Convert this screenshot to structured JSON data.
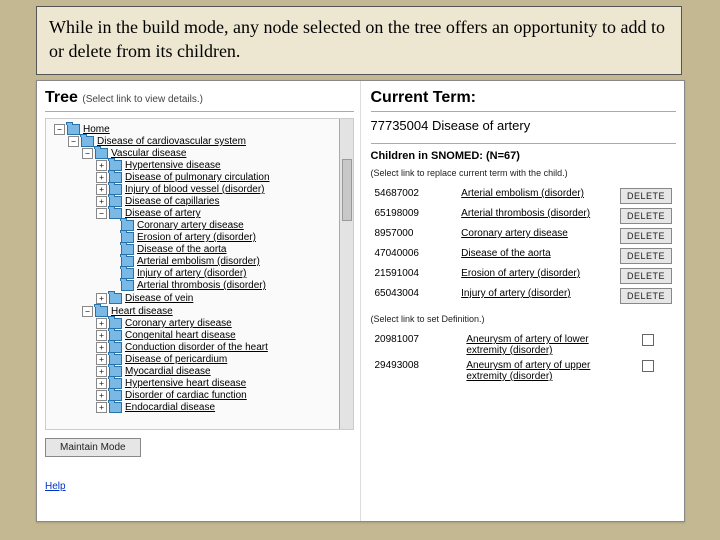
{
  "caption": "While in the build mode, any node selected on the tree offers an opportunity to add to or delete from its children.",
  "left": {
    "heading": "Tree",
    "subheading": "(Select link to view details.)",
    "maintain_button": "Maintain Mode",
    "help_label": "Help",
    "tree": {
      "root_label": "Home",
      "level1_label": "Disease of cardiovascular system",
      "level2": [
        {
          "label": "Vascular disease",
          "expanded": true
        },
        {
          "label": "Heart disease",
          "expanded": true
        }
      ],
      "vascular_children": [
        {
          "label": "Hypertensive disease",
          "collapsed": true
        },
        {
          "label": "Disease of pulmonary circulation",
          "collapsed": true
        },
        {
          "label": "Injury of blood vessel (disorder)",
          "collapsed": true
        },
        {
          "label": "Disease of capillaries",
          "collapsed": true
        },
        {
          "label": "Disease of artery",
          "collapsed": false
        },
        {
          "label": "Disease of vein",
          "collapsed": true
        }
      ],
      "artery_children": [
        "Coronary artery disease",
        "Erosion of artery (disorder)",
        "Disease of the aorta",
        "Arterial embolism (disorder)",
        "Injury of artery (disorder)",
        "Arterial thrombosis (disorder)"
      ],
      "heart_children": [
        "Coronary artery disease",
        "Congenital heart disease",
        "Conduction disorder of the heart",
        "Disease of pericardium",
        "Myocardial disease",
        "Hypertensive heart disease",
        "Disorder of cardiac function",
        "Endocardial disease"
      ]
    }
  },
  "right": {
    "heading": "Current Term:",
    "current_code": "77735004",
    "current_name": "Disease of artery",
    "children_heading": "Children in SNOMED: (N=67)",
    "replace_instruction": "(Select link to replace current term with the child.)",
    "delete_label": "DELETE",
    "children": [
      {
        "code": "54687002",
        "name": "Arterial embolism (disorder)"
      },
      {
        "code": "65198009",
        "name": "Arterial thrombosis (disorder)"
      },
      {
        "code": "8957000",
        "name": "Coronary artery disease"
      },
      {
        "code": "47040006",
        "name": "Disease of the aorta"
      },
      {
        "code": "21591004",
        "name": "Erosion of artery (disorder)"
      },
      {
        "code": "65043004",
        "name": "Injury of artery (disorder)"
      }
    ],
    "definition_instruction": "(Select link to set Definition.)",
    "definition_candidates": [
      {
        "code": "20981007",
        "name": "Aneurysm of artery of lower extremity (disorder)"
      },
      {
        "code": "29493008",
        "name": "Aneurysm of artery of upper extremity (disorder)"
      }
    ]
  }
}
